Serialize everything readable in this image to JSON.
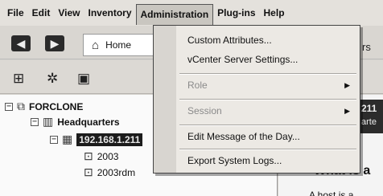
{
  "menubar": {
    "items": [
      "File",
      "Edit",
      "View",
      "Inventory",
      "Administration",
      "Plug-ins",
      "Help"
    ]
  },
  "toolbar": {
    "home_label": "Home",
    "right_fragment": "rs"
  },
  "admin_menu": {
    "items": [
      {
        "label": "Custom Attributes...",
        "enabled": true,
        "submenu": false
      },
      {
        "label": "vCenter Server Settings...",
        "enabled": true,
        "submenu": false
      },
      {
        "label": "Role",
        "enabled": false,
        "submenu": true
      },
      {
        "label": "Session",
        "enabled": false,
        "submenu": true
      },
      {
        "label": "Edit Message of the Day...",
        "enabled": true,
        "submenu": false
      },
      {
        "label": "Export System Logs...",
        "enabled": true,
        "submenu": false
      }
    ]
  },
  "tree": {
    "root": "FORCLONE",
    "datacenter": "Headquarters",
    "host": "192.168.1.211",
    "vms": [
      "2003",
      "2003rdm"
    ]
  },
  "right_panel": {
    "header_num": "211",
    "header_sub": "arte",
    "heading": "What is a",
    "text": "A host is a"
  }
}
